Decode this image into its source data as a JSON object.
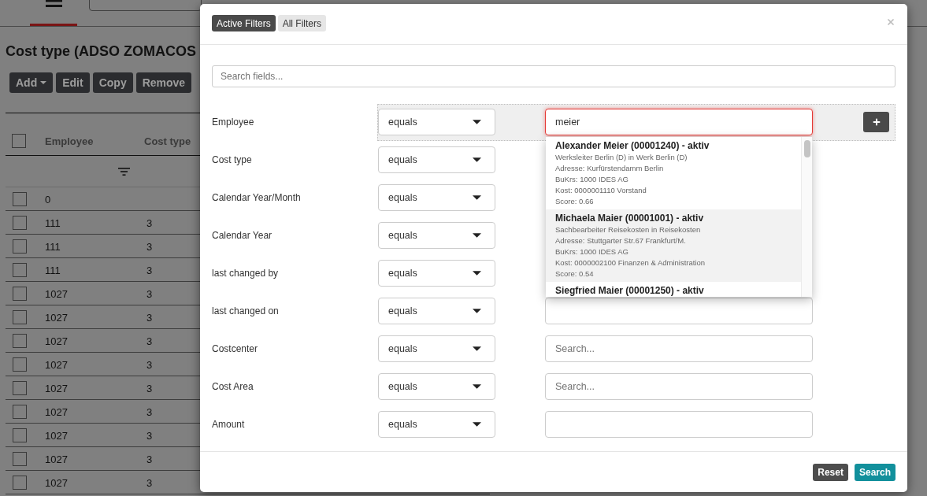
{
  "page": {
    "title": "Cost type (ADSO ZOMACOS",
    "toolbar": [
      {
        "label": "Add",
        "kind": "dropdown"
      },
      {
        "label": "Edit",
        "kind": "plain"
      },
      {
        "label": "Copy",
        "kind": "plain"
      },
      {
        "label": "Remove",
        "kind": "plain"
      }
    ]
  },
  "table": {
    "select_all": {
      "checked": false
    },
    "columns": [
      "Employee",
      "Cost type"
    ],
    "rows": [
      {
        "employee": "0",
        "checked": false
      },
      {
        "employee": "111",
        "cost_type": "3",
        "checked": false
      },
      {
        "employee": "111",
        "cost_type": "3",
        "checked": false
      },
      {
        "employee": "111",
        "cost_type": "3",
        "checked": false
      },
      {
        "employee": "1027",
        "cost_type": "3",
        "checked": false
      },
      {
        "employee": "1027",
        "cost_type": "3",
        "checked": false
      },
      {
        "employee": "1027",
        "cost_type": "3",
        "checked": false
      },
      {
        "employee": "1027",
        "cost_type": "3",
        "checked": false
      },
      {
        "employee": "1027",
        "cost_type": "3",
        "checked": false
      },
      {
        "employee": "1027",
        "cost_type": "3",
        "checked": false
      },
      {
        "employee": "1027",
        "cost_type": "3",
        "checked": false
      },
      {
        "employee": "1027",
        "cost_type": "3",
        "checked": false
      },
      {
        "employee": "1027",
        "cost_type": "3",
        "checked": false
      }
    ]
  },
  "filter_dialog": {
    "tabs": [
      {
        "label": "Active Filters",
        "selected": true
      },
      {
        "label": "All Filters",
        "selected": false
      }
    ],
    "search": {
      "placeholder": "Search fields..."
    },
    "filters": [
      {
        "label": "Employee",
        "operator": "equals",
        "highlighted": true,
        "input": {
          "kind": "text",
          "value": "meier",
          "focused": true,
          "suggestions": [
            {
              "title": "Alexander Meier (00001240) - aktiv",
              "details": [
                "Werksleiter Berlin (D) in Werk Berlin (D)",
                "Adresse: Kurfürstendamm Berlin",
                "BuKrs: 1000 IDES AG",
                "Kost: 0000001110 Vorstand",
                "Score: 0.66"
              ],
              "selected": false
            },
            {
              "title": "Michaela Maier (00001001) - aktiv",
              "details": [
                "Sachbearbeiter Reisekosten in Reisekosten",
                "Adresse: Stuttgarter Str.67 Frankfurt/M.",
                "BuKrs: 1000 IDES AG",
                "Kost: 0000002100 Finanzen & Administration",
                "Score: 0.54"
              ],
              "selected": true
            },
            {
              "title": "Siegfried Maier (00001250) - aktiv",
              "selected": false
            }
          ]
        }
      },
      {
        "label": "Cost type",
        "operator": "equals",
        "highlighted": false
      },
      {
        "label": "Calendar Year/Month",
        "operator": "equals",
        "highlighted": false
      },
      {
        "label": "Calendar Year",
        "operator": "equals",
        "highlighted": false
      },
      {
        "label": "last changed by",
        "operator": "equals",
        "highlighted": false
      },
      {
        "label": "last changed on",
        "operator": "equals",
        "highlighted": false,
        "input": {
          "kind": "text",
          "focused": false
        }
      },
      {
        "label": "Costcenter",
        "operator": "equals",
        "highlighted": false,
        "input": {
          "kind": "text",
          "placeholder": "Search...",
          "focused": false
        }
      },
      {
        "label": "Cost Area",
        "operator": "equals",
        "highlighted": false,
        "input": {
          "kind": "text",
          "placeholder": "Search...",
          "focused": false
        }
      },
      {
        "label": "Amount",
        "operator": "equals",
        "highlighted": false,
        "input": {
          "kind": "text",
          "focused": false
        }
      }
    ],
    "buttons": [
      {
        "label": "Reset",
        "kind": "secondary"
      },
      {
        "label": "Search",
        "kind": "primary"
      }
    ]
  }
}
